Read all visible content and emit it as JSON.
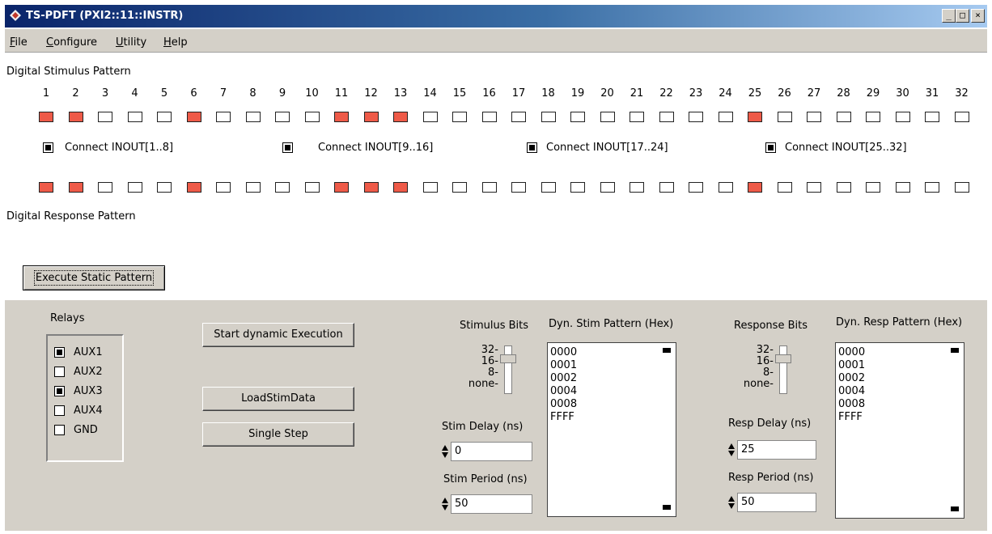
{
  "window": {
    "title": "TS-PDFT (PXI2::11::INSTR)",
    "controls": [
      "_",
      "□",
      "×"
    ]
  },
  "menu": [
    "File",
    "Configure",
    "Utility",
    "Help"
  ],
  "stimulus": {
    "label": "Digital Stimulus Pattern",
    "bits": [
      "1",
      "2",
      "3",
      "4",
      "5",
      "6",
      "7",
      "8",
      "9",
      "10",
      "11",
      "12",
      "13",
      "14",
      "15",
      "16",
      "17",
      "18",
      "19",
      "20",
      "21",
      "22",
      "23",
      "24",
      "25",
      "26",
      "27",
      "28",
      "29",
      "30",
      "31",
      "32"
    ],
    "states": [
      1,
      1,
      0,
      0,
      0,
      1,
      0,
      0,
      0,
      0,
      1,
      1,
      1,
      0,
      0,
      0,
      0,
      0,
      0,
      0,
      0,
      0,
      0,
      0,
      1,
      0,
      0,
      0,
      0,
      0,
      0,
      0
    ]
  },
  "connect": [
    {
      "label": "Connect INOUT[1..8]",
      "checked": true
    },
    {
      "label": "Connect INOUT[9..16]",
      "checked": true
    },
    {
      "label": "Connect INOUT[17..24]",
      "checked": true
    },
    {
      "label": "Connect INOUT[25..32]",
      "checked": true
    }
  ],
  "response": {
    "label": "Digital Response Pattern",
    "states": [
      1,
      1,
      0,
      0,
      0,
      1,
      0,
      0,
      0,
      0,
      1,
      1,
      1,
      0,
      0,
      0,
      0,
      0,
      0,
      0,
      0,
      0,
      0,
      0,
      1,
      0,
      0,
      0,
      0,
      0,
      0,
      0
    ]
  },
  "execute_static_label": "Execute Static Pattern",
  "relays": {
    "label": "Relays",
    "items": [
      {
        "label": "AUX1",
        "checked": true
      },
      {
        "label": "AUX2",
        "checked": false
      },
      {
        "label": "AUX3",
        "checked": true
      },
      {
        "label": "AUX4",
        "checked": false
      },
      {
        "label": "GND",
        "checked": false
      }
    ]
  },
  "buttons": {
    "start_dynamic": "Start dynamic Execution",
    "load_stim": "LoadStimData",
    "single_step": "Single Step"
  },
  "stim": {
    "bits_label": "Stimulus Bits",
    "slider_ticks": [
      "32-",
      "16-",
      "8-",
      "none-"
    ],
    "delay_label": "Stim Delay (ns)",
    "delay_value": "0",
    "period_label": "Stim Period (ns)",
    "period_value": "50",
    "pattern_label": "Dyn. Stim Pattern (Hex)",
    "pattern": [
      "0000",
      "0001",
      "0002",
      "0004",
      "0008",
      "FFFF"
    ]
  },
  "resp": {
    "bits_label": "Response Bits",
    "slider_ticks": [
      "32-",
      "16-",
      "8-",
      "none-"
    ],
    "delay_label": "Resp Delay (ns)",
    "delay_value": "25",
    "period_label": "Resp Period (ns)",
    "period_value": "50",
    "pattern_label": "Dyn. Resp Pattern (Hex)",
    "pattern": [
      "0000",
      "0001",
      "0002",
      "0004",
      "0008",
      "FFFF"
    ]
  }
}
